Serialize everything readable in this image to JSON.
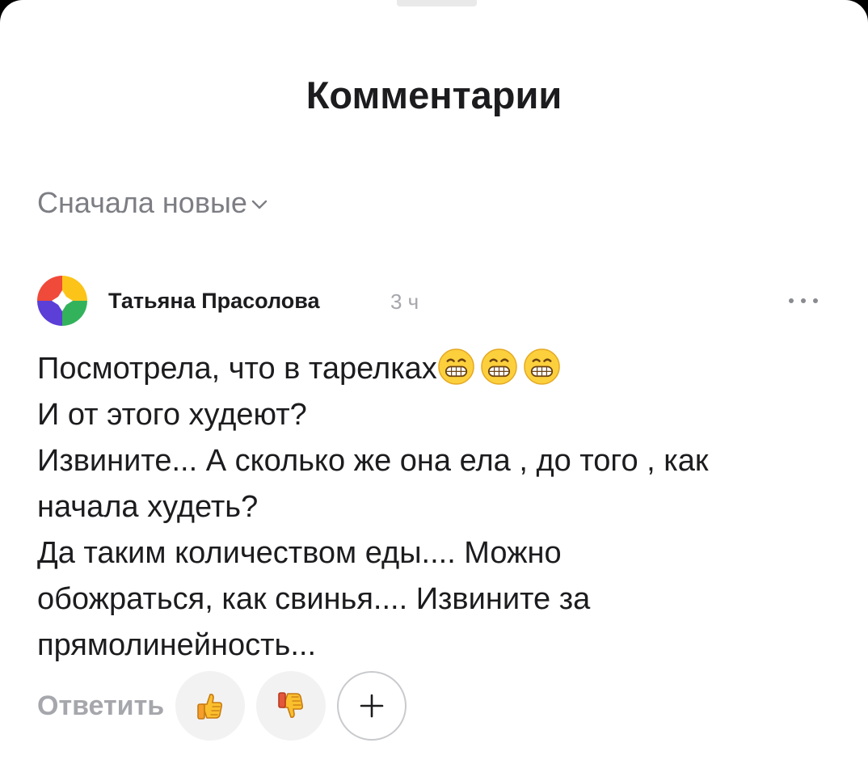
{
  "sheet": {
    "title": "Комментарии"
  },
  "sort": {
    "label": "Сначала новые",
    "icon": "chevron-down-icon"
  },
  "comment": {
    "author": "Татьяна Прасолова",
    "time": "3 ч",
    "more_icon": "more-horizontal-icon",
    "lines": [
      "Посмотрела, что в тарелках",
      "И от этого худеют?",
      "Извините... А сколько же она ела , до того , как",
      "начала худеть?",
      "Да таким количеством еды.... Можно",
      "обожраться, как свинья.... Извините за",
      "прямолинейность..."
    ],
    "emoji": [
      "😁",
      "😁",
      "😁"
    ]
  },
  "actions": {
    "reply_label": "Ответить",
    "like_icon": "thumbs-up-icon",
    "dislike_icon": "thumbs-down-icon",
    "add_reaction_icon": "plus-icon"
  },
  "colors": {
    "title": "#1c1c1f",
    "muted": "#7d7e84",
    "faint": "#a6a7ac",
    "button_bg": "#f2f2f3"
  }
}
